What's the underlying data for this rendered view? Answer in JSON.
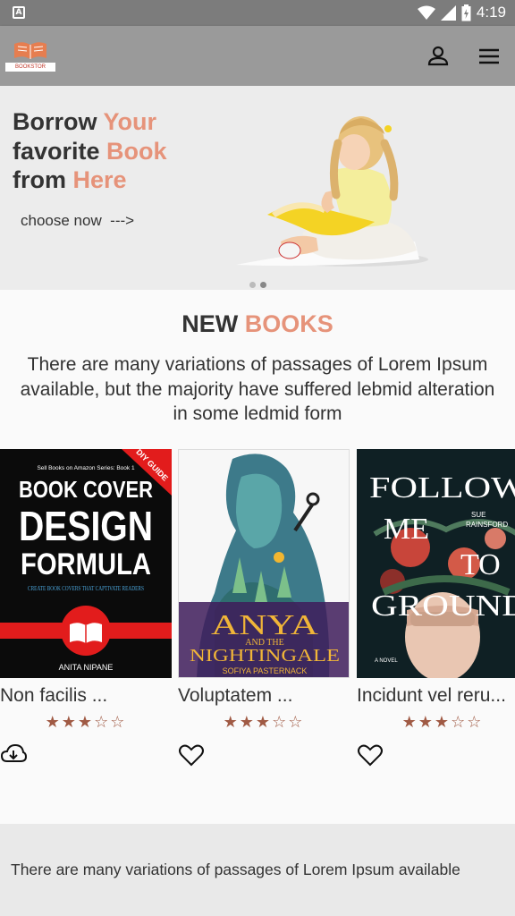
{
  "status_bar": {
    "time": "4:19",
    "left_icon": "android-a-icon",
    "right_icons": [
      "wifi-icon",
      "signal-icon",
      "battery-icon"
    ]
  },
  "app_bar": {
    "logo_text": "BOOKSTOR",
    "icons": [
      "account-icon",
      "menu-icon"
    ]
  },
  "banner": {
    "line1_plain": "Borrow ",
    "line1_accent": "Your",
    "line2_plain": "favorite ",
    "line2_accent": "Book",
    "line3_plain": "from ",
    "line3_accent": "Here",
    "cta": "choose now  --->",
    "slides_total": 2,
    "active_slide": 2
  },
  "new_books": {
    "title_plain": "NEW",
    "title_accent": "BOOKS",
    "description": "There are many variations of passages of Lorem Ipsum available, but the majority have suffered lebmid alteration in some ledmid form",
    "books": [
      {
        "cover_top": "Sell Books on Amazon Series: Book 1",
        "cover_line1": "BOOK COVER",
        "cover_line2": "DESIGN",
        "cover_line3": "FORMULA",
        "cover_sub": "CREATE BOOK COVERS THAT CAPTIVATE READERS",
        "cover_author": "ANITA NIPANE",
        "cover_ribbon": "DIY GUIDE",
        "title": "Non facilis ...",
        "rating": 3,
        "stars": "★★★☆☆",
        "action_icon": "cloud-download-icon"
      },
      {
        "cover_line1": "ANYA",
        "cover_line2": "AND THE",
        "cover_line3": "NIGHTINGALE",
        "cover_author": "SOFIYA PASTERNACK",
        "title": "Voluptatem ...",
        "rating": 3,
        "stars": "★★★☆☆",
        "action_icon": "heart-outline-icon"
      },
      {
        "cover_line1": "FOLLOW",
        "cover_line2": "ME",
        "cover_line3": "TO",
        "cover_line4": "GROUND",
        "cover_author_1": "SUE",
        "cover_author_2": "RAINSFORD",
        "cover_tag": "A NOVEL",
        "title": "Incidunt vel reru...",
        "rating": 3,
        "stars": "★★★☆☆",
        "action_icon": "heart-outline-icon"
      }
    ]
  },
  "footer": {
    "text": "There are many variations of passages of Lorem Ipsum available"
  },
  "colors": {
    "accent": "#e6937a",
    "star": "#a05a44",
    "app_bar": "#9a9a9a"
  }
}
